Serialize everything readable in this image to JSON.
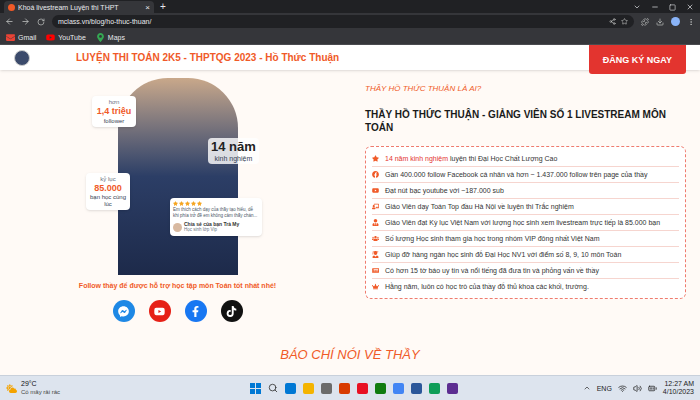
{
  "browser": {
    "tab_title": "Khoá livestream Luyện thi THPT",
    "tab_close": "×",
    "new_tab": "+",
    "url": "mclass.vn/blog/ho-thuc-thuan/",
    "bookmarks": [
      "Gmail",
      "YouTube",
      "Maps"
    ]
  },
  "header": {
    "title": "LUYỆN THI TOÁN 2K5 - THPTQG 2023 - Hồ Thức Thuận",
    "cta": "ĐĂNG KÝ NGAY"
  },
  "profile": {
    "followers_prefix": "hơn",
    "followers_value": "1,4 triệu",
    "followers_label": "follower",
    "experience_value": "14 năm",
    "experience_label": "kinh nghiệm",
    "record_prefix": "kỷ lục",
    "record_value": "85.000",
    "record_label": "bạn học cùng lúc",
    "review": {
      "stars": 5,
      "text": "Em thích cách dạy của thầy tạo hiểu, dễ khi phía trở đề em không cảm thấy chán...",
      "author": "Chia sẻ của bạn Trà My",
      "role": "Học sinh lớp Vip"
    },
    "follow_text": "Follow thầy để được hỗ trợ học tập môn Toán tốt nhất nhé!",
    "socials": [
      {
        "kind": "messenger",
        "color": "#1e88e5"
      },
      {
        "kind": "youtube",
        "color": "#e62117"
      },
      {
        "kind": "facebook",
        "color": "#1877f2"
      },
      {
        "kind": "tiktok",
        "color": "#111111"
      }
    ]
  },
  "about": {
    "subtitle": "THẦY HỒ THỨC THUẬN LÀ AI?",
    "heading": "THẦY HỒ THỨC THUẬN - GIẢNG VIÊN SỐ 1 LIVESTREAM MÔN TOÁN",
    "items": [
      {
        "highlight": "14 năm kinh nghiệm",
        "text": " luyện thi Đại Học Chất Lượng Cao"
      },
      {
        "text": "Gần 400.000 follow Facebook cá nhân và hơn ~ 1.437.000 follow trên page của thầy"
      },
      {
        "text": "Đạt nút bạc youtube với ~187.000 sub"
      },
      {
        "text": "Giáo Viên dạy Toán Top đầu Hà Nội về luyện thi Trắc nghiệm"
      },
      {
        "text": "Giáo Viên đạt Kỷ lục Việt Nam với lượng học sinh xem livestream trực tiếp là 85.000 bạn"
      },
      {
        "text": "Số lượng Học sinh tham gia học trong nhóm VIP đông nhất Việt Nam"
      },
      {
        "text": "Giúp đỡ hàng ngàn học sinh đỗ Đại Học NV1 với điểm số 8, 9, 10 môn Toán"
      },
      {
        "text": "Có hơn 15 tờ báo uy tín và nổi tiếng đã đưa tin và phỏng vấn về thầy"
      },
      {
        "text": "Hằng năm, luôn có học trò của thầy đỗ thủ khoa các khối, trường."
      }
    ]
  },
  "press_title": "BÁO CHÍ NÓI VỀ THẦY",
  "taskbar": {
    "temperature": "29°C",
    "weather": "Có mây rải rác",
    "language": "ENG",
    "time": "12:27 AM",
    "date": "4/10/2023"
  }
}
